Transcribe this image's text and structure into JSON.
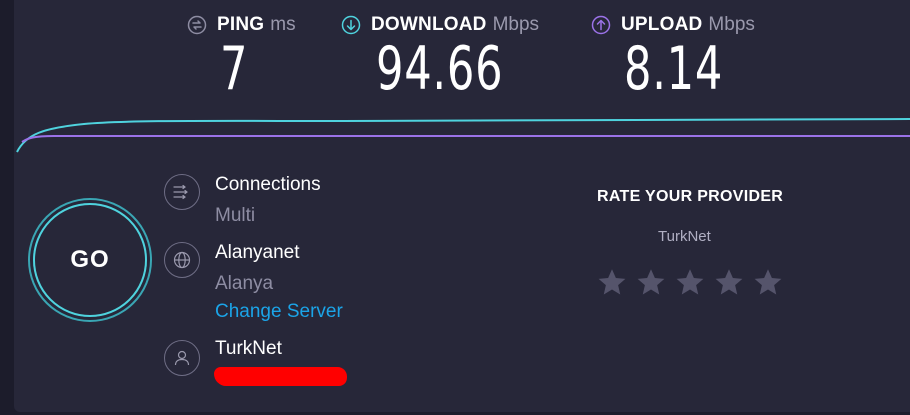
{
  "metrics": {
    "ping": {
      "label": "PING",
      "unit": "ms",
      "value": "7",
      "icon": "ping-icon"
    },
    "download": {
      "label": "DOWNLOAD",
      "unit": "Mbps",
      "value": "94.66",
      "icon": "download-arrow-icon"
    },
    "upload": {
      "label": "UPLOAD",
      "unit": "Mbps",
      "value": "8.14",
      "icon": "upload-arrow-icon"
    }
  },
  "go_button": {
    "label": "GO"
  },
  "connections": {
    "title": "Connections",
    "value": "Multi",
    "icon": "connections-icon"
  },
  "server": {
    "name": "Alanyanet",
    "location": "Alanya",
    "change_label": "Change Server",
    "icon": "globe-icon"
  },
  "isp": {
    "name": "TurkNet",
    "icon": "user-icon"
  },
  "rating": {
    "title": "RATE YOUR PROVIDER",
    "provider": "TurkNet",
    "stars_total": 5,
    "stars_selected": 0
  },
  "colors": {
    "background": "#1c1c2b",
    "panel": "#272739",
    "download": "#4fd3de",
    "upload": "#9b72e8",
    "ping": "#8e8da3",
    "link": "#1ba4e8",
    "star": "#55546b",
    "redaction": "#ff0000"
  }
}
